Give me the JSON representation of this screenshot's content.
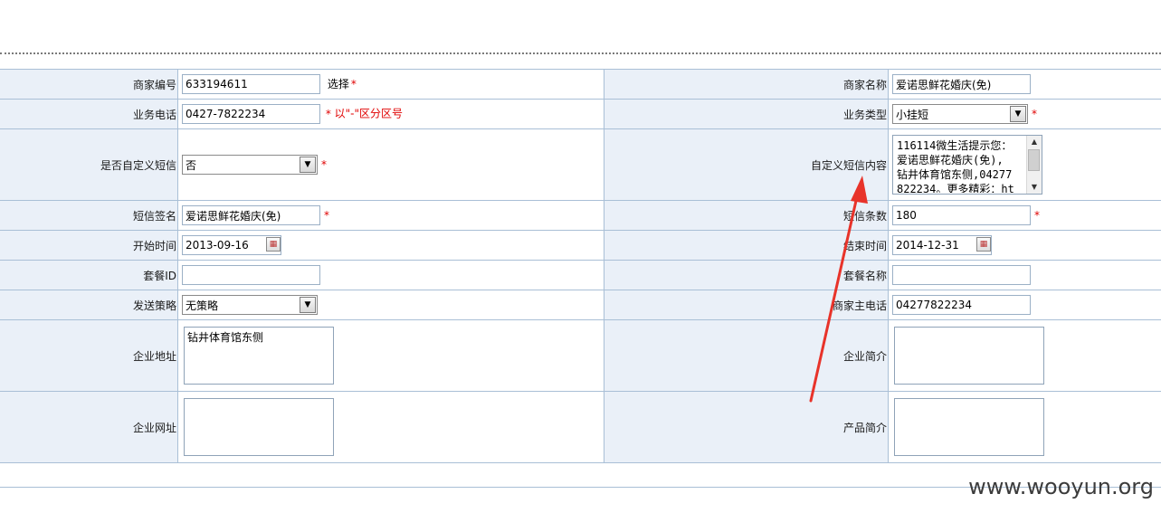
{
  "form": {
    "merchant_no_label": "商家编号",
    "merchant_no_value": "633194611",
    "select_link": "选择",
    "merchant_name_label": "商家名称",
    "merchant_name_value": "爱诺思鲜花婚庆(免)",
    "biz_phone_label": "业务电话",
    "biz_phone_value": "0427-7822234",
    "biz_phone_hint": "以\"-\"区分区号",
    "biz_type_label": "业务类型",
    "biz_type_value": "小挂短",
    "custom_sms_label": "是否自定义短信",
    "custom_sms_value": "否",
    "sms_content_label": "自定义短信内容",
    "sms_content_value": "116114微生活提示您：\n爱诺思鲜花婚庆(免),\n钻井体育馆东侧,04277\n822234。更多精彩：ht",
    "sms_sign_label": "短信签名",
    "sms_sign_value": "爱诺思鲜花婚庆(免)",
    "sms_count_label": "短信条数",
    "sms_count_value": "180",
    "start_time_label": "开始时间",
    "start_time_value": "2013-09-16",
    "end_time_label": "结束时间",
    "end_time_value": "2014-12-31",
    "package_id_label": "套餐ID",
    "package_id_value": "",
    "package_name_label": "套餐名称",
    "package_name_value": "",
    "send_policy_label": "发送策略",
    "send_policy_value": "无策略",
    "main_phone_label": "商家主电话",
    "main_phone_value": "04277822234",
    "address_label": "企业地址",
    "address_value": "钻井体育馆东侧",
    "intro_label": "企业简介",
    "intro_value": "",
    "website_label": "企业网址",
    "website_value": "",
    "product_label": "产品简介",
    "product_value": "",
    "required_mark": "*"
  },
  "watermark": "www.wooyun.org",
  "colors": {
    "label_bg": "#eaf0f8",
    "border": "#a9bfd6",
    "required": "#e00000",
    "annotation_arrow": "#e8332a"
  }
}
